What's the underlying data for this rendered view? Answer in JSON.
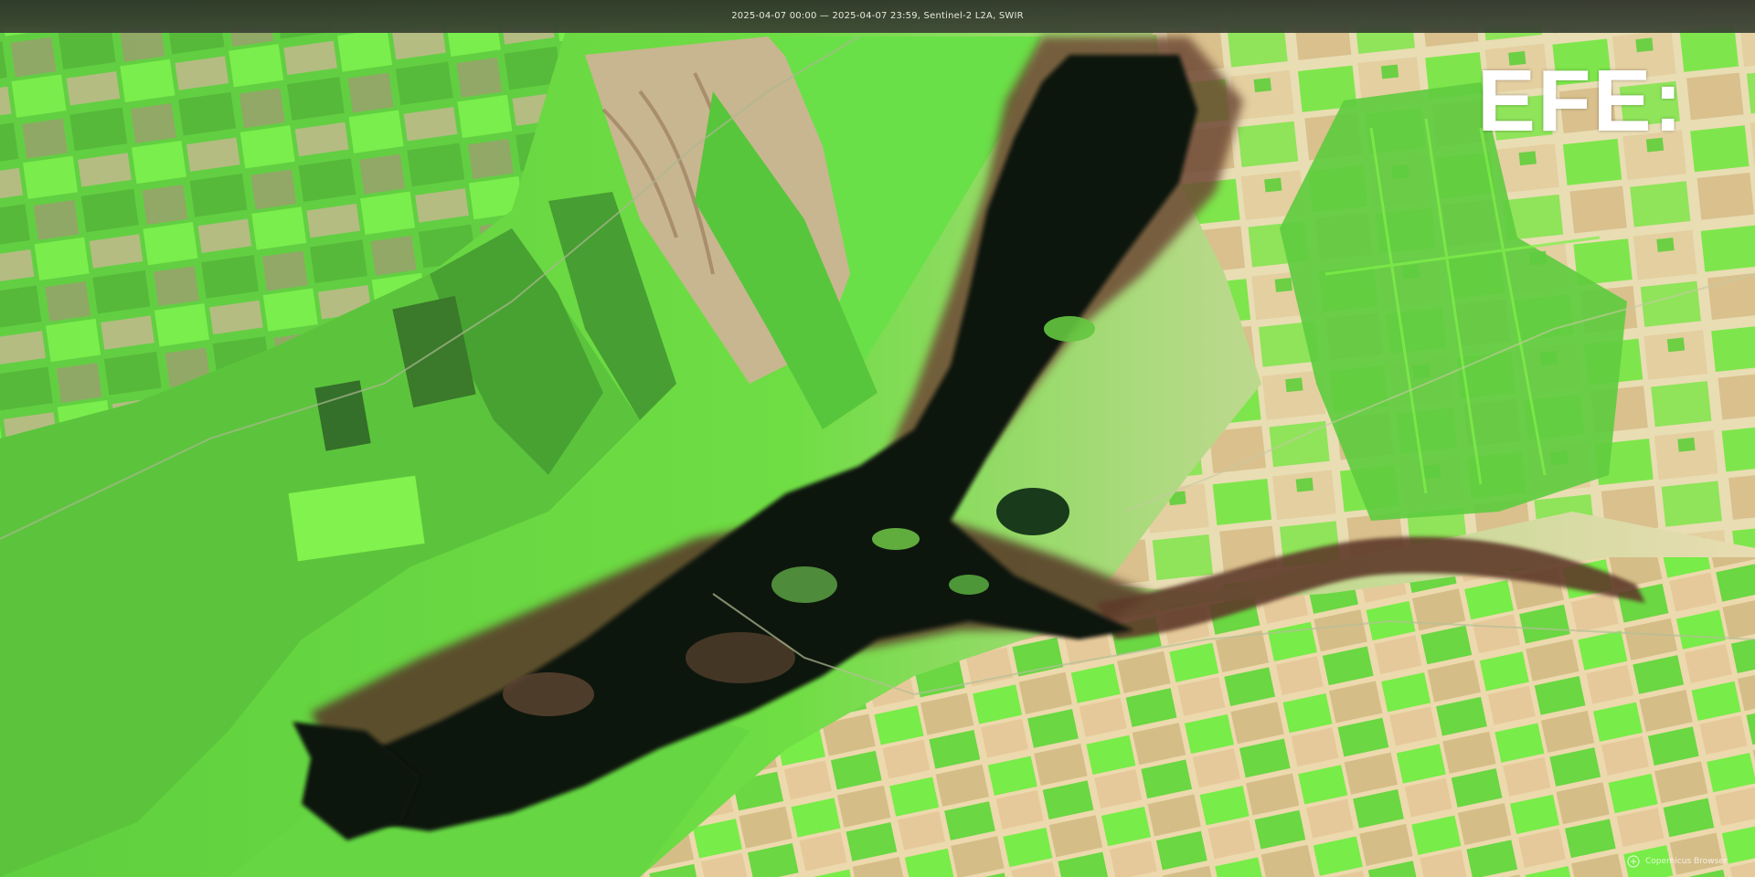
{
  "image": {
    "subject": "satellite-imagery-flooded-river-valley",
    "colors": {
      "vegetation_bright": "#7ff04a",
      "vegetation_mid": "#58c73c",
      "vegetation_dark": "#3c8a2c",
      "bare_soil": "#e9dfb8",
      "soil_warm": "#c9b27f",
      "floodwater": "#0d120c",
      "wet_edge": "#4a3a28"
    }
  },
  "header": {
    "caption": "2025-04-07 00:00 — 2025-04-07 23:59, Sentinel-2 L2A, SWIR"
  },
  "logo": {
    "text": "EFE:"
  },
  "credit": {
    "text": "Copernicus Browser",
    "icon": "copernicus-logo-icon"
  }
}
